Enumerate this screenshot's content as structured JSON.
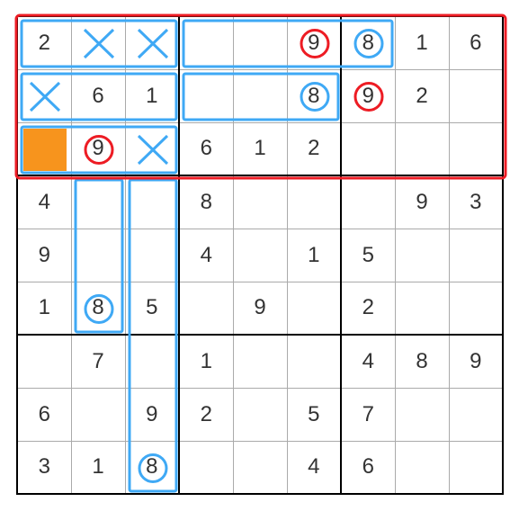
{
  "grid": [
    [
      "2",
      "",
      "",
      "",
      "",
      "9",
      "8",
      "1",
      "6"
    ],
    [
      "",
      "6",
      "1",
      "",
      "",
      "8",
      "9",
      "2",
      ""
    ],
    [
      "",
      "9",
      "",
      "6",
      "1",
      "2",
      "",
      "",
      ""
    ],
    [
      "4",
      "",
      "",
      "8",
      "",
      "",
      "",
      "9",
      "3"
    ],
    [
      "9",
      "",
      "",
      "4",
      "",
      "1",
      "5",
      "",
      ""
    ],
    [
      "1",
      "8",
      "5",
      "",
      "9",
      "",
      "2",
      "",
      ""
    ],
    [
      "",
      "7",
      "",
      "1",
      "",
      "",
      "4",
      "8",
      "9"
    ],
    [
      "6",
      "",
      "9",
      "2",
      "",
      "5",
      "7",
      "",
      ""
    ],
    [
      "3",
      "1",
      "8",
      "",
      "",
      "4",
      "6",
      "",
      ""
    ]
  ],
  "highlighted_cell": {
    "row": 2,
    "col": 0
  },
  "circles": [
    {
      "row": 0,
      "col": 5,
      "color": "red"
    },
    {
      "row": 0,
      "col": 6,
      "color": "blue"
    },
    {
      "row": 1,
      "col": 5,
      "color": "blue"
    },
    {
      "row": 1,
      "col": 6,
      "color": "red"
    },
    {
      "row": 2,
      "col": 1,
      "color": "red"
    },
    {
      "row": 5,
      "col": 1,
      "color": "blue"
    },
    {
      "row": 8,
      "col": 2,
      "color": "blue"
    }
  ],
  "x_marks": [
    {
      "row": 0,
      "col": 1
    },
    {
      "row": 0,
      "col": 2
    },
    {
      "row": 1,
      "col": 0
    },
    {
      "row": 2,
      "col": 2
    }
  ],
  "colors": {
    "highlight": "#f7941d",
    "blue": "#3fa9f5",
    "red": "#ed1c24"
  }
}
